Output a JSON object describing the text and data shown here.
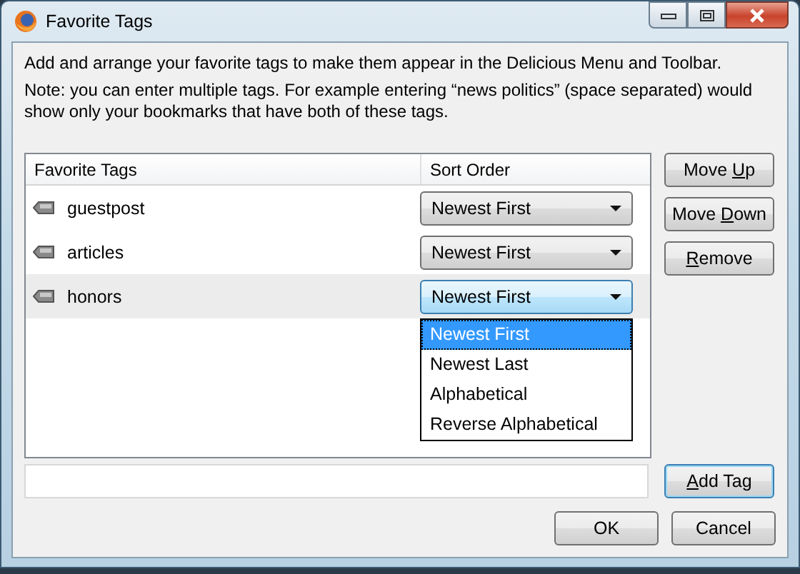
{
  "window": {
    "title": "Favorite Tags"
  },
  "intro": "Add and arrange your favorite tags to make them appear in the Delicious Menu and Toolbar.",
  "note": "Note: you can enter multiple tags. For example entering “news politics” (space separated) would show only your bookmarks that have both of these tags.",
  "table": {
    "columns": [
      "Favorite Tags",
      "Sort Order"
    ],
    "rows": [
      {
        "name": "guestpost",
        "sort": "Newest First",
        "selected": false,
        "open": false
      },
      {
        "name": "articles",
        "sort": "Newest First",
        "selected": false,
        "open": false
      },
      {
        "name": "honors",
        "sort": "Newest First",
        "selected": true,
        "open": true,
        "options": [
          {
            "label": "Newest First",
            "selected": true
          },
          {
            "label": "Newest Last",
            "selected": false
          },
          {
            "label": "Alphabetical",
            "selected": false
          },
          {
            "label": "Reverse Alphabetical",
            "selected": false
          }
        ]
      }
    ]
  },
  "side_buttons": [
    {
      "label_parts": {
        "before": "Move ",
        "key": "U",
        "after": "p"
      },
      "focused": false
    },
    {
      "label_parts": {
        "before": "Move ",
        "key": "D",
        "after": "own"
      },
      "focused": false
    },
    {
      "label_parts": {
        "key": "R",
        "after": "emove"
      },
      "focused": false
    }
  ],
  "add_button": {
    "label_parts": {
      "key": "A",
      "after": "dd Tag"
    },
    "focused": true
  },
  "buttons": [
    {
      "label_parts": {
        "before": "OK"
      },
      "focused": false
    },
    {
      "label_parts": {
        "before": "Cancel"
      },
      "focused": false
    }
  ]
}
